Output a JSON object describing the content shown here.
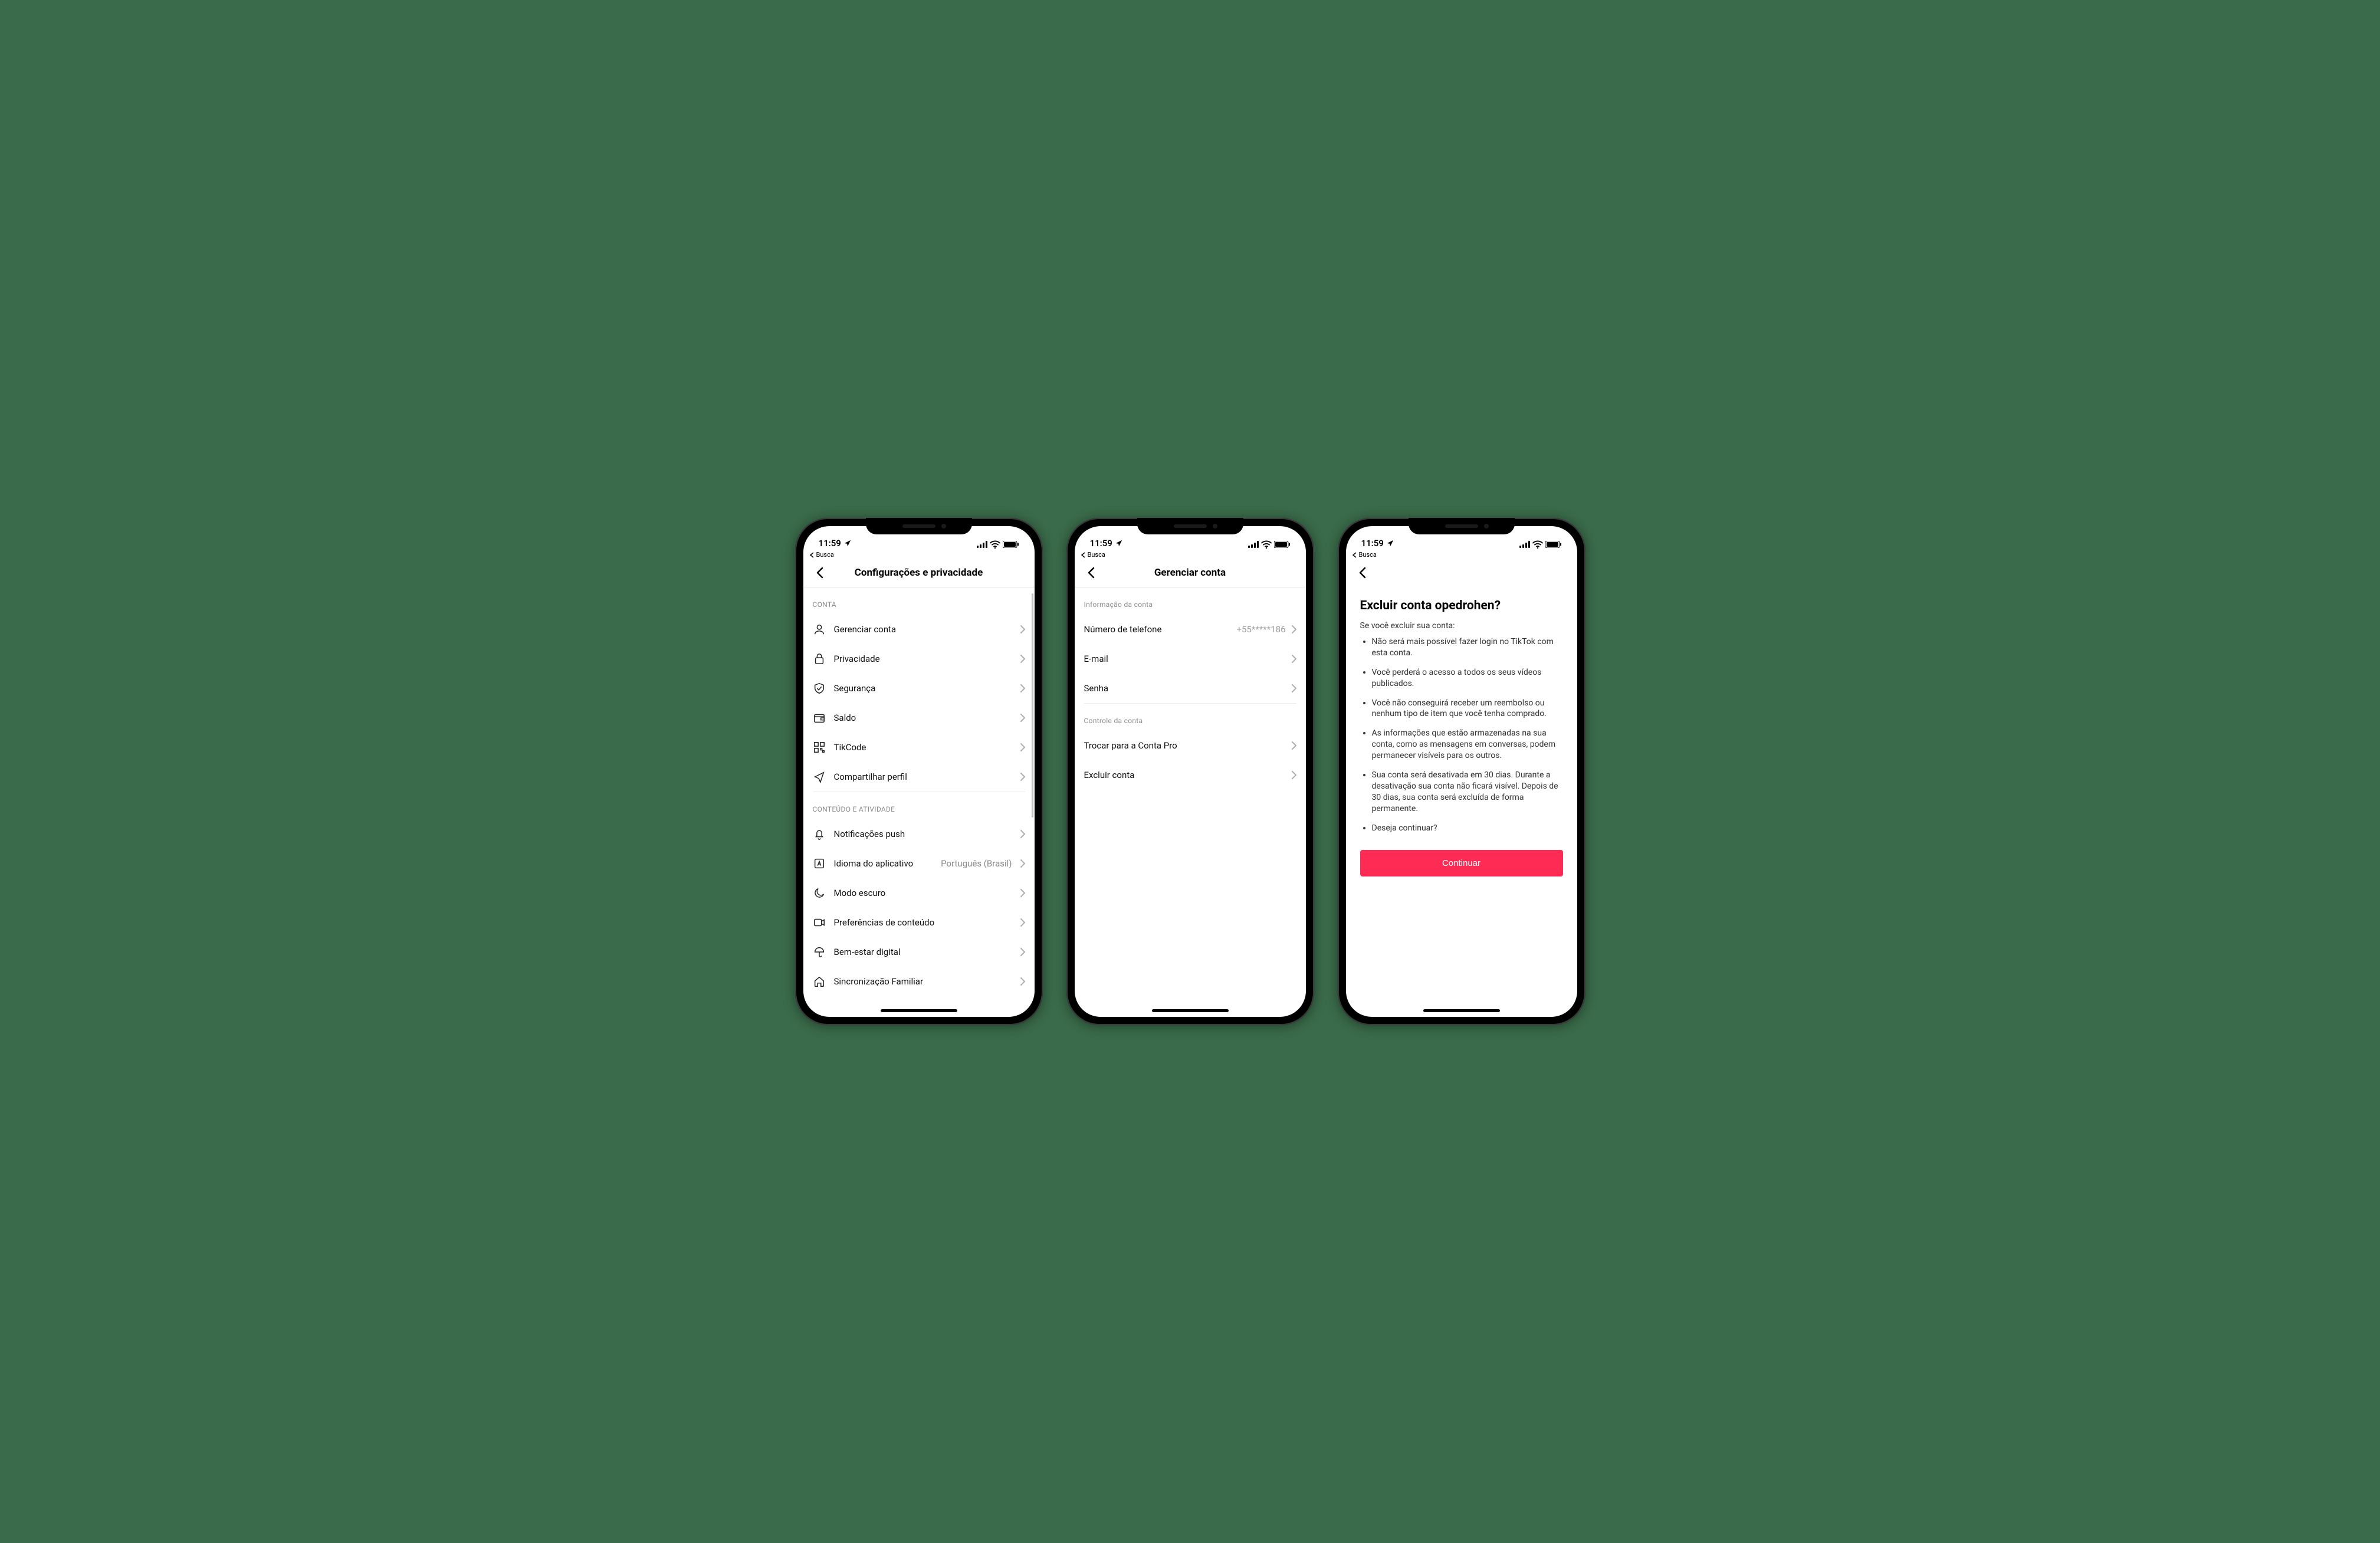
{
  "status": {
    "time": "11:59",
    "breadcrumb": "Busca"
  },
  "screen1": {
    "title": "Configurações e privacidade",
    "section_conta": "CONTA",
    "items_conta": [
      {
        "label": "Gerenciar conta"
      },
      {
        "label": "Privacidade"
      },
      {
        "label": "Segurança"
      },
      {
        "label": "Saldo"
      },
      {
        "label": "TikCode"
      },
      {
        "label": "Compartilhar perfil"
      }
    ],
    "section_conteudo": "CONTEÚDO E ATIVIDADE",
    "items_conteudo": [
      {
        "label": "Notificações push"
      },
      {
        "label": "Idioma do aplicativo",
        "value": "Português (Brasil)"
      },
      {
        "label": "Modo escuro"
      },
      {
        "label": "Preferências de conteúdo"
      },
      {
        "label": "Bem-estar digital"
      },
      {
        "label": "Sincronização Familiar"
      }
    ]
  },
  "screen2": {
    "title": "Gerenciar conta",
    "section_info": "Informação da conta",
    "items_info": [
      {
        "label": "Número de telefone",
        "value": "+55*****186"
      },
      {
        "label": "E-mail"
      },
      {
        "label": "Senha"
      }
    ],
    "section_control": "Controle da conta",
    "items_control": [
      {
        "label": "Trocar para a Conta Pro"
      },
      {
        "label": "Excluir conta"
      }
    ]
  },
  "screen3": {
    "title": "Excluir conta opedrohen?",
    "subtitle": "Se você excluir sua conta:",
    "bullets": [
      "Não será mais possível fazer login no TikTok com esta conta.",
      "Você perderá o acesso a todos os seus vídeos publicados.",
      "Você não conseguirá receber um reembolso ou nenhum tipo de item que você tenha comprado.",
      "As informações que estão armazenadas na sua conta, como as mensagens em conversas, podem permanecer visíveis para os outros.",
      "Sua conta será desativada em 30 dias. Durante a desativação sua conta não ficará visível. Depois de 30 dias, sua conta será excluída de forma permanente.",
      "Deseja continuar?"
    ],
    "button": "Continuar"
  }
}
